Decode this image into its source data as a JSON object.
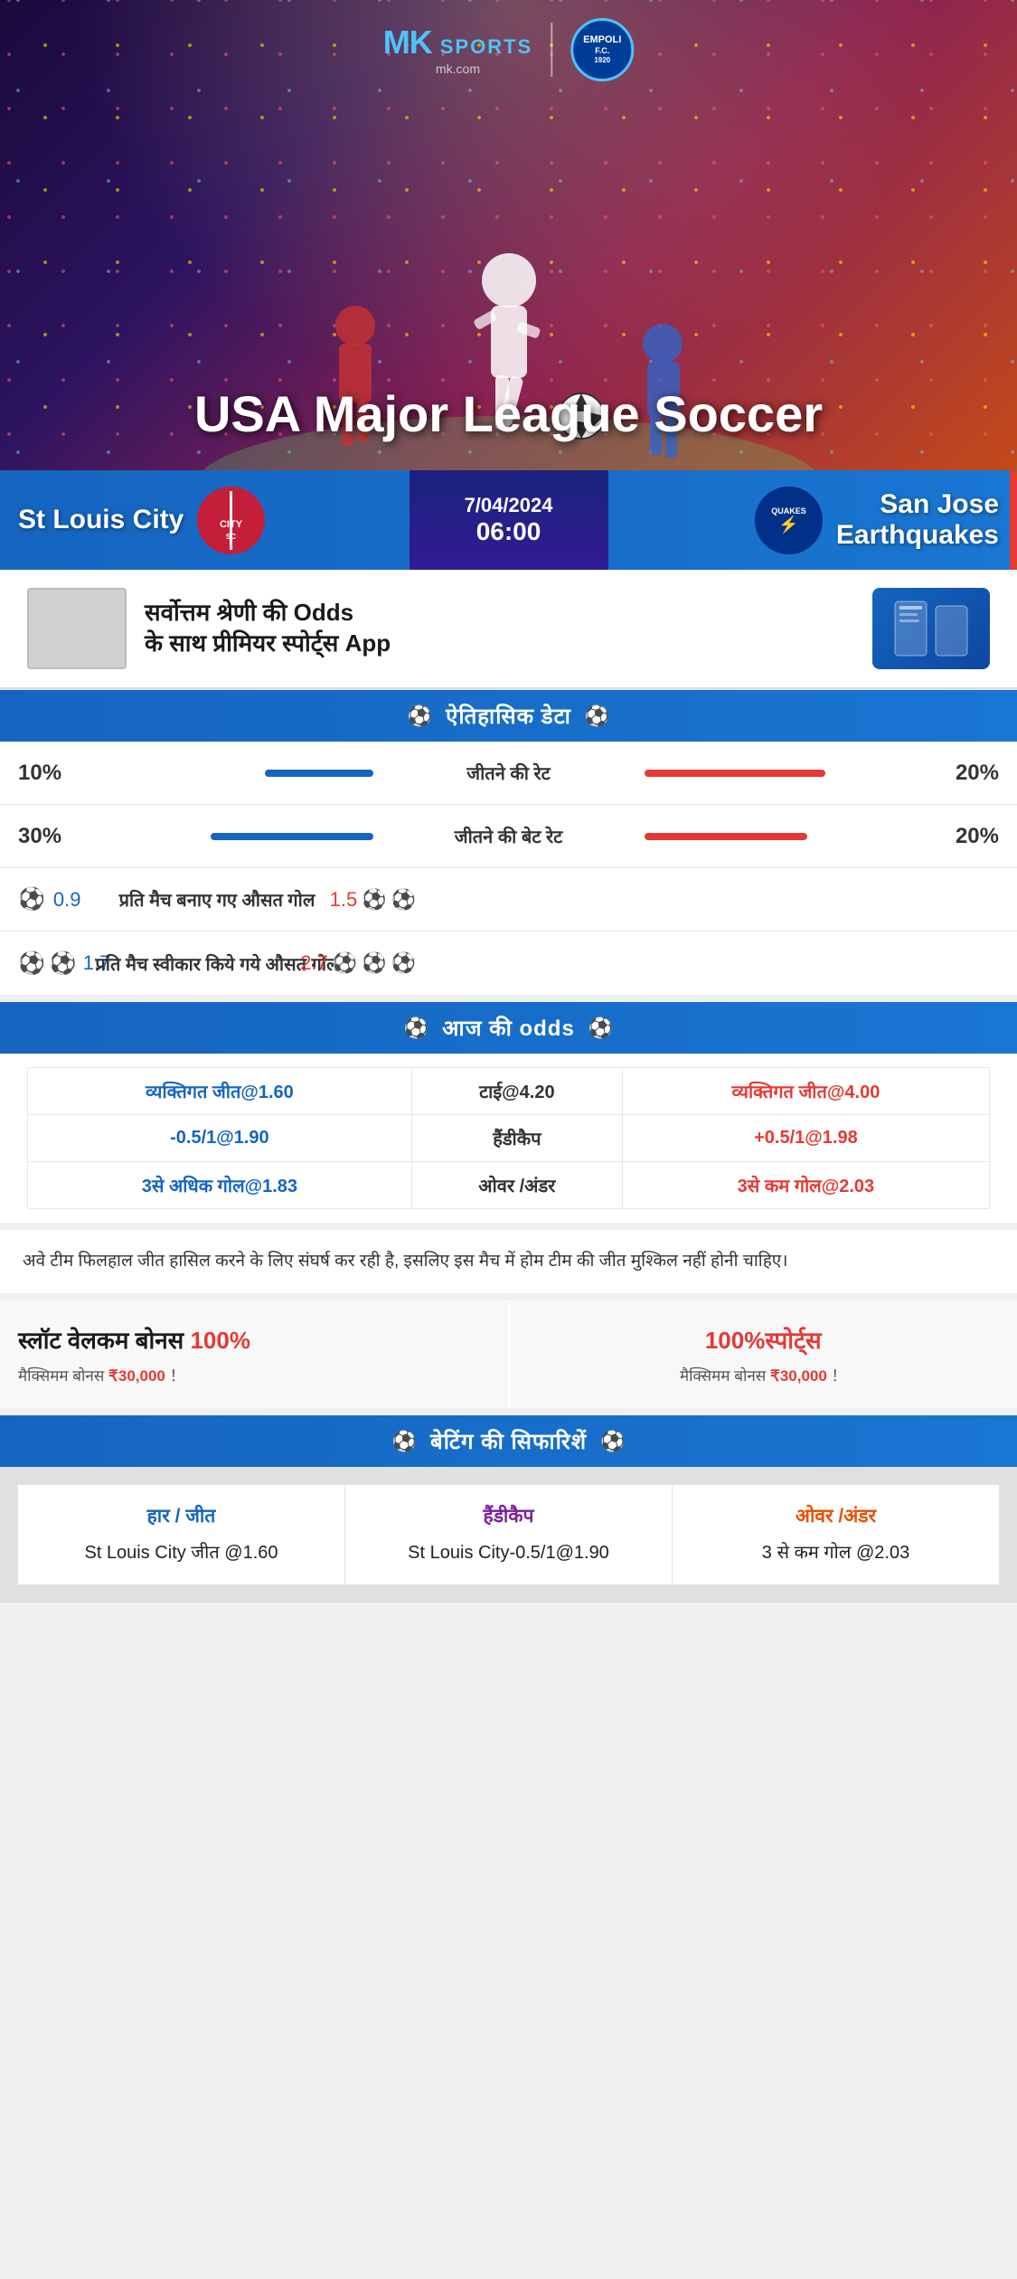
{
  "brand": {
    "name_mk": "MK",
    "name_sports": "SPORTS",
    "domain": "mk.com",
    "empoli_text": "EMPOLI F.C.\n1920"
  },
  "hero": {
    "title": "USA Major League Soccer"
  },
  "match": {
    "home_team": "St Louis City",
    "away_team": "San Jose Earthquakes",
    "away_team_line1": "San Jose",
    "away_team_line2": "Earthquakes",
    "date": "7/04/2024",
    "time": "06:00",
    "away_logo_text": "QUAKES"
  },
  "promo": {
    "text_line1": "सर्वोत्तम श्रेणी की Odds",
    "text_line2": "के साथ प्रीमियर स्पोर्ट्स App"
  },
  "historical": {
    "section_title": "ऐतिहासिक डेटा",
    "stats": [
      {
        "label": "जीतने की रेट",
        "left_val": "10%",
        "right_val": "20%",
        "left_bar_width": 120,
        "right_bar_width": 200,
        "type": "bar"
      },
      {
        "label": "जीतने की बेट रेट",
        "left_val": "30%",
        "right_val": "20%",
        "left_bar_width": 180,
        "right_bar_width": 180,
        "type": "bar"
      },
      {
        "label": "प्रति मैच बनाए गए औसत गोल",
        "left_val": "0.9",
        "right_val": "1.5",
        "left_icons": 1,
        "right_icons": 2,
        "type": "icon"
      },
      {
        "label": "प्रति मैच स्वीकार किये गये औसत गोल",
        "left_val": "1.7",
        "right_val": "2.7",
        "left_icons": 2,
        "right_icons": 3,
        "type": "icon"
      }
    ]
  },
  "odds": {
    "section_title": "आज की odds",
    "rows": [
      {
        "home": "व्यक्तिगत जीत@1.60",
        "center": "टाई@4.20",
        "away": "व्यक्तिगत जीत@4.00"
      },
      {
        "home": "-0.5/1@1.90",
        "center": "हैंडीकैप",
        "away": "+0.5/1@1.98"
      },
      {
        "home": "3से अधिक गोल@1.83",
        "center": "ओवर /अंडर",
        "away": "3से कम गोल@2.03"
      }
    ]
  },
  "analysis": {
    "text": "अवे टीम फिलहाल जीत हासिल करने के लिए संघर्ष कर रही है, इसलिए इस मैच में होम टीम की जीत मुश्किल नहीं होनी चाहिए।"
  },
  "bonus": {
    "left_title": "स्लॉट वेलकम बोनस 100%",
    "left_subtitle": "मैक्सिमम बोनस ₹30,000  ！",
    "right_title": "100%स्पोर्ट्स",
    "right_subtitle": "मैक्सिमम बोनस  ₹30,000 ！"
  },
  "recommendations": {
    "section_title": "बेटिंग की सिफारिशें",
    "items": [
      {
        "type": "हार / जीत",
        "value": "St Louis City जीत @1.60",
        "color": "blue"
      },
      {
        "type": "हैंडीकैप",
        "value": "St Louis City-0.5/1@1.90",
        "color": "purple"
      },
      {
        "type": "ओवर /अंडर",
        "value": "3 से कम गोल @2.03",
        "color": "orange"
      }
    ]
  }
}
